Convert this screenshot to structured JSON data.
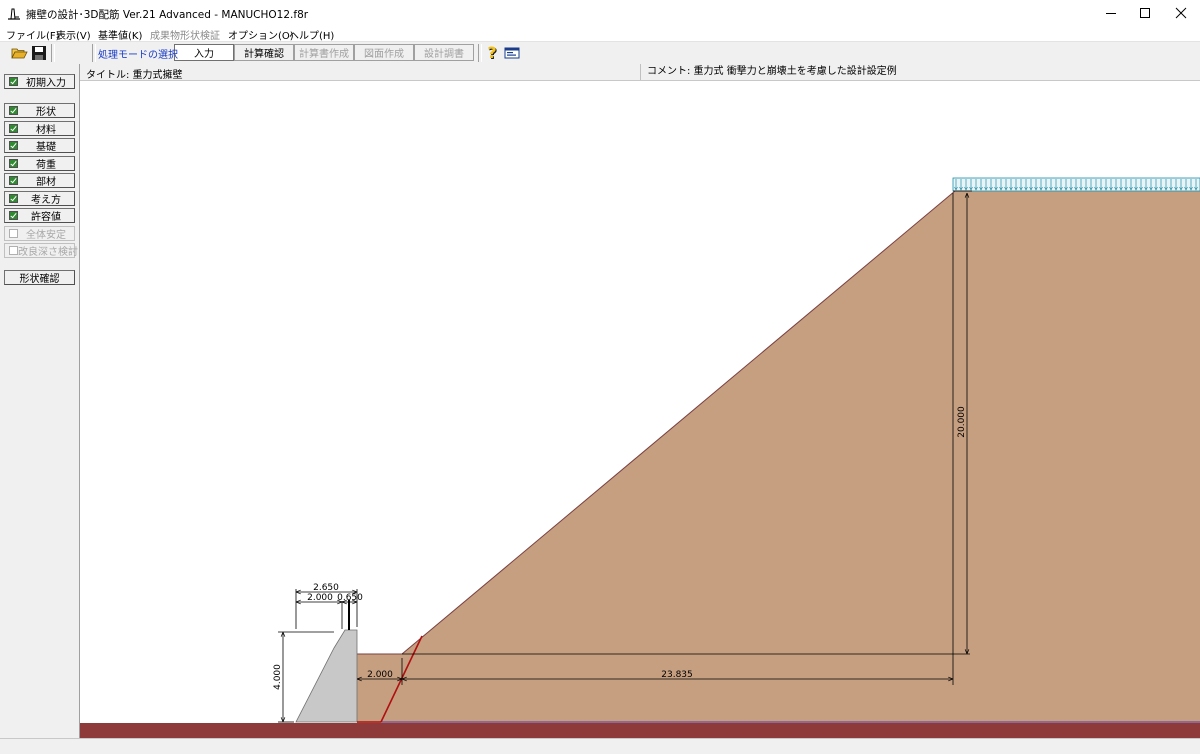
{
  "window": {
    "title": "擁壁の設計･3D配筋 Ver.21 Advanced  - MANUCHO12.f8r",
    "icons": {
      "app": "retaining-wall-app-icon",
      "minimize": "minimize-icon",
      "maximize": "maximize-icon",
      "close": "close-icon"
    }
  },
  "menu": {
    "items": [
      {
        "label": "ファイル(F)",
        "enabled": true
      },
      {
        "label": "表示(V)",
        "enabled": true
      },
      {
        "label": "基準値(K)",
        "enabled": true
      },
      {
        "label": "成果物形状検証",
        "enabled": false
      },
      {
        "label": "オプション(O)",
        "enabled": true
      },
      {
        "label": "ヘルプ(H)",
        "enabled": true
      }
    ]
  },
  "toolbar": {
    "mode_label": "処理モードの選択",
    "buttons": [
      {
        "label": "入力",
        "state": "active"
      },
      {
        "label": "計算確認",
        "state": "enabled"
      },
      {
        "label": "計算書作成",
        "state": "disabled"
      },
      {
        "label": "図面作成",
        "state": "disabled"
      },
      {
        "label": "設計調書",
        "state": "disabled"
      }
    ],
    "icons": [
      "open-folder-icon",
      "save-icon",
      "help-icon",
      "about-icon"
    ]
  },
  "sidebar": {
    "initial_input": "初期入力",
    "items": [
      {
        "label": "形状",
        "checked": true,
        "enabled": true
      },
      {
        "label": "材料",
        "checked": true,
        "enabled": true
      },
      {
        "label": "基礎",
        "checked": true,
        "enabled": true
      },
      {
        "label": "荷重",
        "checked": true,
        "enabled": true
      },
      {
        "label": "部材",
        "checked": true,
        "enabled": true
      },
      {
        "label": "考え方",
        "checked": true,
        "enabled": true
      },
      {
        "label": "許容値",
        "checked": true,
        "enabled": true
      },
      {
        "label": "全体安定",
        "checked": false,
        "enabled": false
      },
      {
        "label": "改良深さ検討",
        "checked": false,
        "enabled": false
      }
    ],
    "shape_check": "形状確認"
  },
  "info": {
    "title": "タイトル: 重力式擁壁",
    "comment": "コメント: 重力式 衝撃力と崩壊土を考慮した設計設定例"
  },
  "drawing": {
    "colors": {
      "soil": "#c69f81",
      "ground": "#8e3a3a",
      "wall": "#c8c8c8",
      "load": "#1e8fa8",
      "failure_line": "#b01010",
      "dim": "#000000"
    },
    "dimensions": {
      "top_total": "2.650",
      "top_left": "2.000",
      "top_right": "0.650",
      "wall_height": "4.000",
      "pocket_width": "2.000",
      "slope_width": "23.835",
      "slope_height": "20.000"
    }
  }
}
